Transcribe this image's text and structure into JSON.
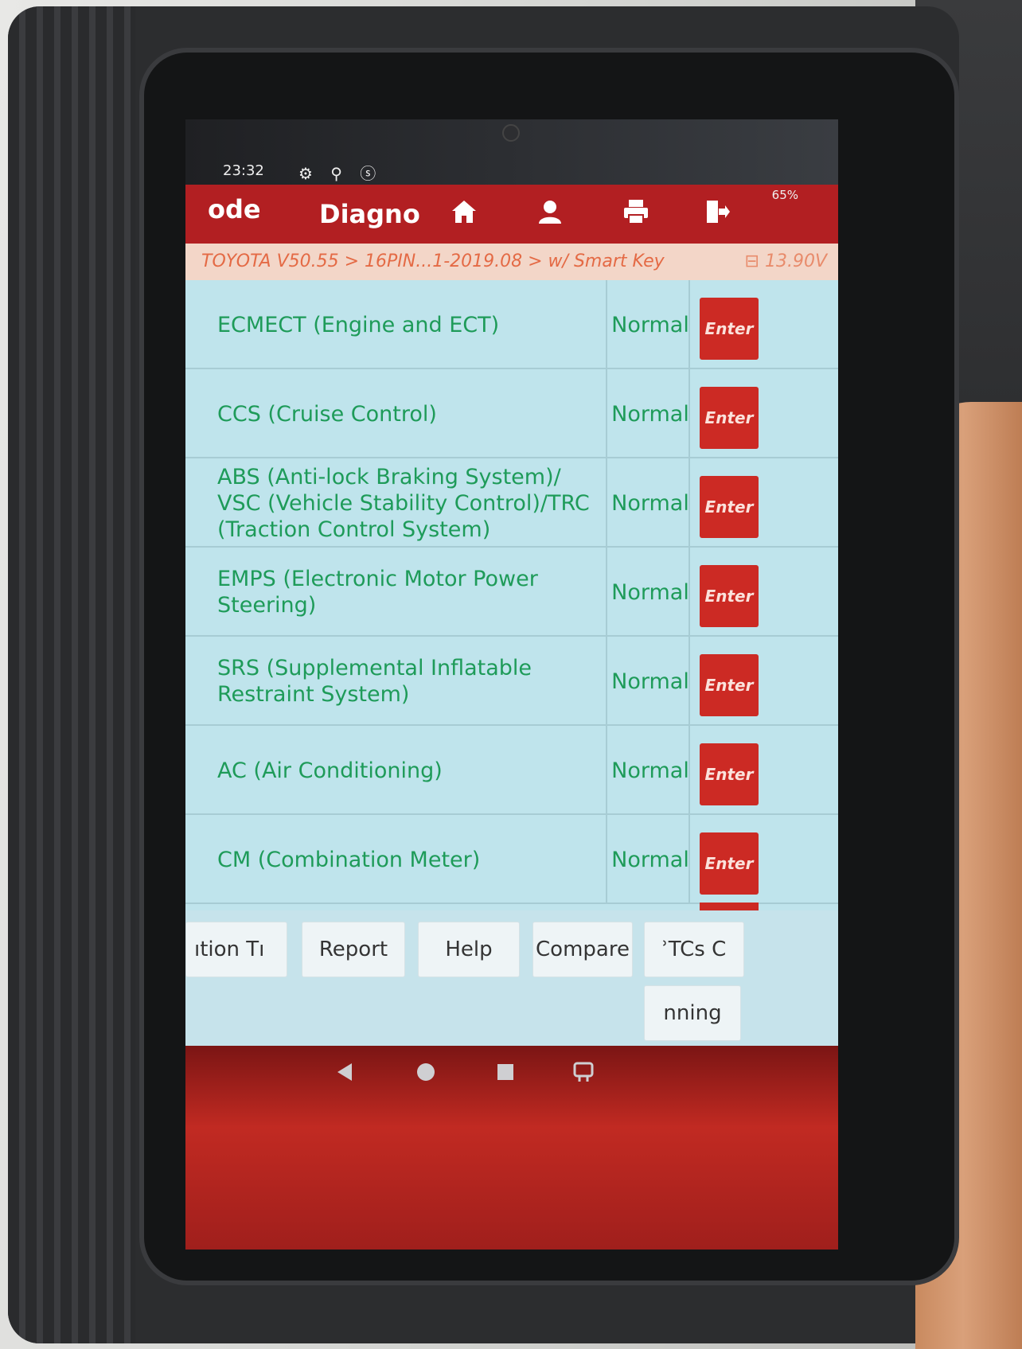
{
  "status_bar": {
    "time": "23:32",
    "icons": "⚙ ⚲ ⓢ",
    "battery": "65%"
  },
  "top_bar": {
    "title_left": "ode",
    "title_center": "Diagno"
  },
  "breadcrumb": {
    "path": "TOYOTA V50.55 > 16PIN...1-2019.08 > w/ Smart Key",
    "voltage": "13.90V"
  },
  "systems": [
    {
      "name": "ECMECT (Engine and ECT)",
      "status": "Normal",
      "action": "Enter"
    },
    {
      "name": "CCS (Cruise Control)",
      "status": "Normal",
      "action": "Enter"
    },
    {
      "name": "ABS (Anti-lock Braking System)/ VSC (Vehicle Stability Control)/TRC (Traction Control System)",
      "status": "Normal",
      "action": "Enter"
    },
    {
      "name": "EMPS (Electronic Motor Power Steering)",
      "status": "Normal",
      "action": "Enter"
    },
    {
      "name": "SRS (Supplemental Inflatable Restraint System)",
      "status": "Normal",
      "action": "Enter"
    },
    {
      "name": "AC (Air Conditioning)",
      "status": "Normal",
      "action": "Enter"
    },
    {
      "name": "CM (Combination Meter)",
      "status": "Normal",
      "action": "Enter"
    }
  ],
  "bottom_buttons": {
    "b1": "ıtion    Tı",
    "b2": "Report",
    "b3": "Help",
    "b4": "Compare",
    "b5": "ʾTCs    C",
    "b6": "nning"
  },
  "icons": {
    "home": "home-icon",
    "user": "user-icon",
    "print": "print-icon",
    "exit": "exit-icon",
    "back": "back-icon",
    "nav_home": "nav-home-icon",
    "recent": "recent-apps-icon",
    "vci": "vci-icon"
  }
}
